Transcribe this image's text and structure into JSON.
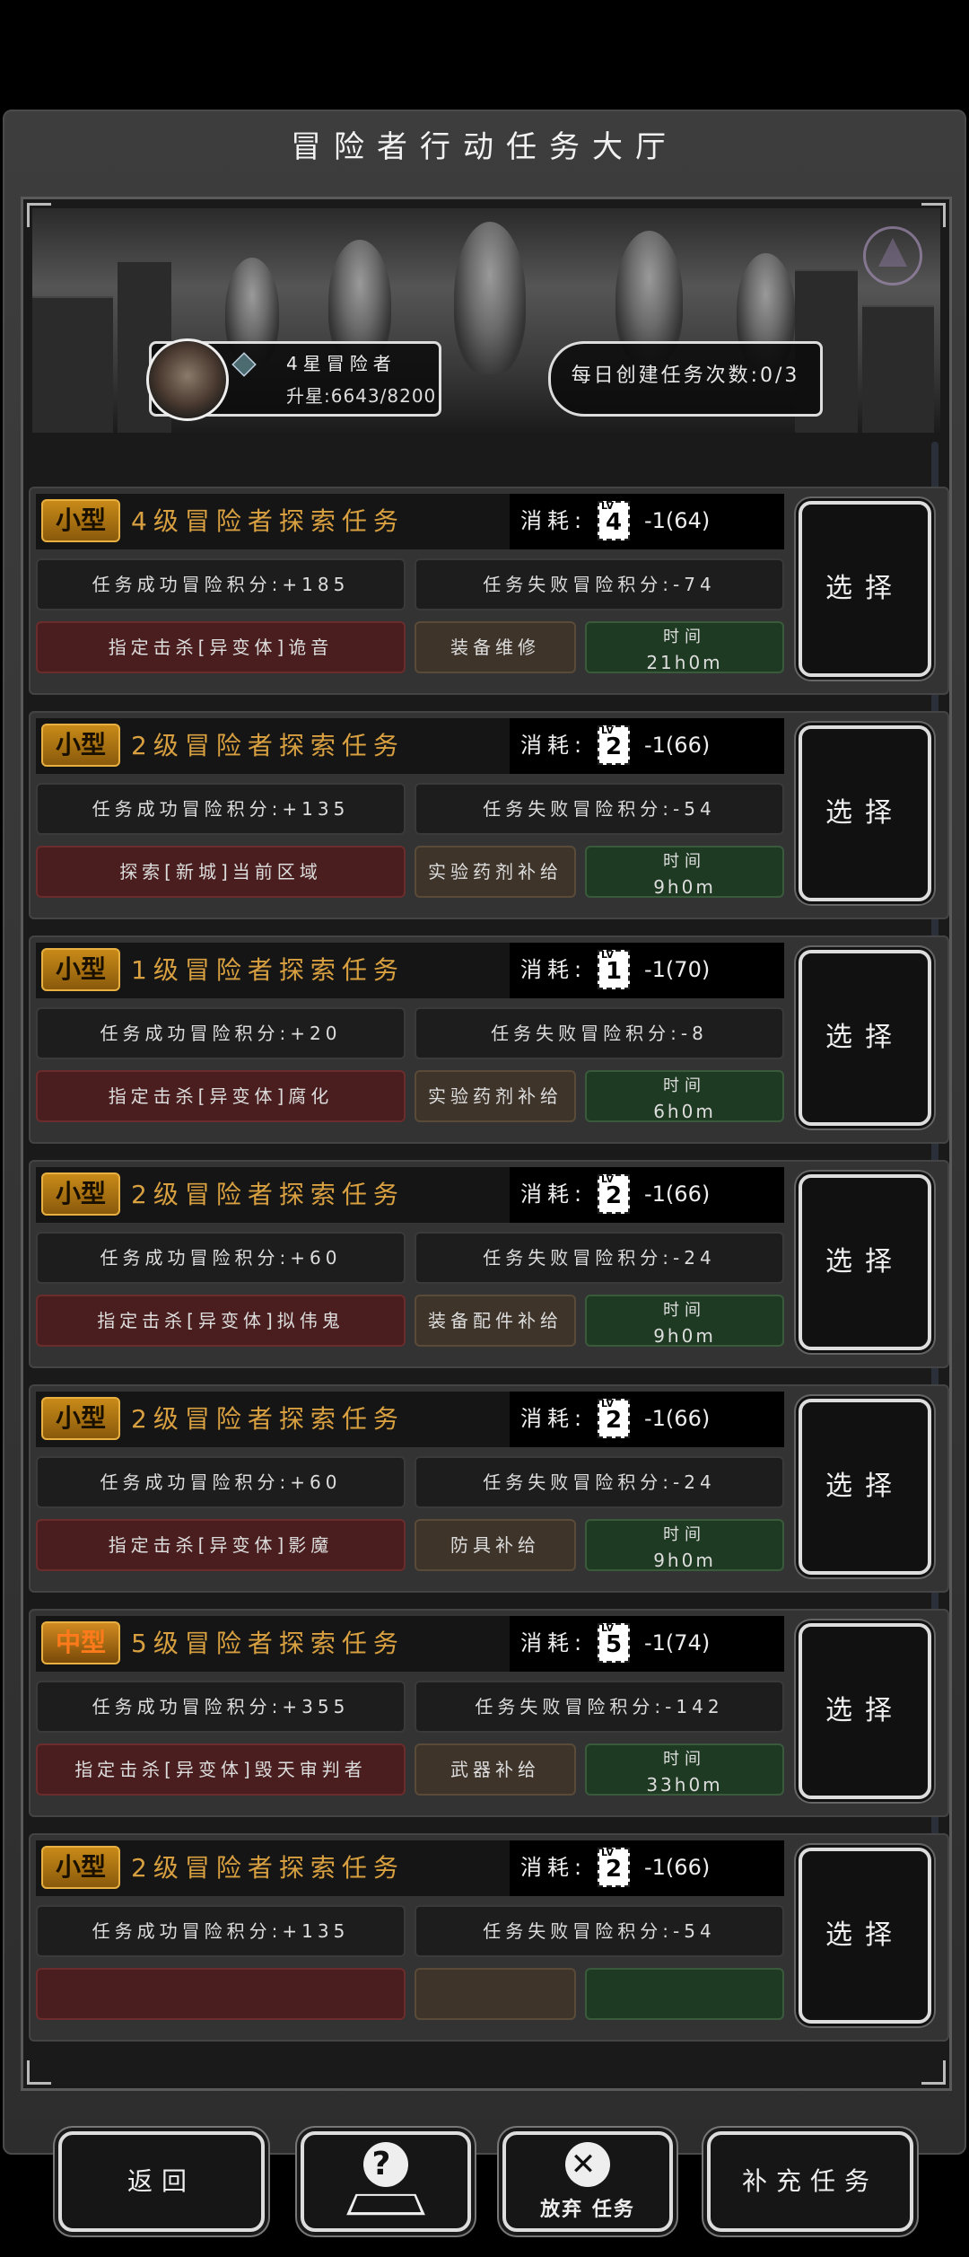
{
  "title": "冒险者行动任务大厅",
  "rank": {
    "name": "4星冒险者",
    "exp": "升星:6643/8200"
  },
  "daily": {
    "label": "每日创建任务次数:0/3"
  },
  "cost_label": "消耗:",
  "lv_prefix": "LV",
  "select_label": "选择",
  "time_label": "时间",
  "tasks": [
    {
      "size": "小型",
      "name": "4级冒险者探索任务",
      "lv": "4",
      "cost": "-1(64)",
      "success": "任务成功冒险积分:+185",
      "fail": "任务失败冒险积分:-74",
      "target": "指定击杀[异变体]诡音",
      "reward": "装备维修",
      "time": "21h0m"
    },
    {
      "size": "小型",
      "name": "2级冒险者探索任务",
      "lv": "2",
      "cost": "-1(66)",
      "success": "任务成功冒险积分:+135",
      "fail": "任务失败冒险积分:-54",
      "target": "探索[新城]当前区域",
      "reward": "实验药剂补给",
      "time": "9h0m"
    },
    {
      "size": "小型",
      "name": "1级冒险者探索任务",
      "lv": "1",
      "cost": "-1(70)",
      "success": "任务成功冒险积分:+20",
      "fail": "任务失败冒险积分:-8",
      "target": "指定击杀[异变体]腐化",
      "reward": "实验药剂补给",
      "time": "6h0m"
    },
    {
      "size": "小型",
      "name": "2级冒险者探索任务",
      "lv": "2",
      "cost": "-1(66)",
      "success": "任务成功冒险积分:+60",
      "fail": "任务失败冒险积分:-24",
      "target": "指定击杀[异变体]拟伟鬼",
      "reward": "装备配件补给",
      "time": "9h0m"
    },
    {
      "size": "小型",
      "name": "2级冒险者探索任务",
      "lv": "2",
      "cost": "-1(66)",
      "success": "任务成功冒险积分:+60",
      "fail": "任务失败冒险积分:-24",
      "target": "指定击杀[异变体]影魔",
      "reward": "防具补给",
      "time": "9h0m"
    },
    {
      "size": "中型",
      "name": "5级冒险者探索任务",
      "lv": "5",
      "cost": "-1(74)",
      "success": "任务成功冒险积分:+355",
      "fail": "任务失败冒险积分:-142",
      "target": "指定击杀[异变体]毁天审判者",
      "reward": "武器补给",
      "time": "33h0m"
    },
    {
      "size": "小型",
      "name": "2级冒险者探索任务",
      "lv": "2",
      "cost": "-1(66)",
      "success": "任务成功冒险积分:+135",
      "fail": "任务失败冒险积分:-54",
      "target": "",
      "reward": "",
      "time": ""
    }
  ],
  "footer": {
    "back": "返回",
    "abandon": "放弃 任务",
    "supplement": "补充任务"
  },
  "icons": {
    "help": "help-map-icon",
    "abandon": "close-circle-icon"
  },
  "colors": {
    "tag_gold": "#c88a18",
    "name_gold": "#d8a040",
    "target_red": "#4a1e1e",
    "reward_brown": "#3e342a",
    "time_green": "#1f3a22"
  }
}
